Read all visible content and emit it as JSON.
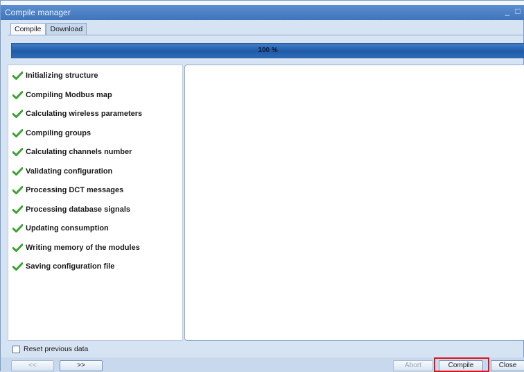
{
  "window": {
    "title": "Compile manager",
    "controls": [
      "minimize",
      "maximize"
    ]
  },
  "tabs": [
    {
      "label": "Compile",
      "active": true
    },
    {
      "label": "Download",
      "active": false
    }
  ],
  "progress": {
    "label": "100 %",
    "percent": 100
  },
  "steps": [
    {
      "label": "Initializing structure",
      "status": "done"
    },
    {
      "label": "Compiling Modbus map",
      "status": "done"
    },
    {
      "label": "Calculating wireless parameters",
      "status": "done"
    },
    {
      "label": "Compiling groups",
      "status": "done"
    },
    {
      "label": "Calculating channels number",
      "status": "done"
    },
    {
      "label": "Validating configuration",
      "status": "done"
    },
    {
      "label": "Processing DCT messages",
      "status": "done"
    },
    {
      "label": "Processing database signals",
      "status": "done"
    },
    {
      "label": "Updating consumption",
      "status": "done"
    },
    {
      "label": "Writing memory of the modules",
      "status": "done"
    },
    {
      "label": "Saving configuration file",
      "status": "done"
    }
  ],
  "options": {
    "reset_label": "Reset previous data",
    "reset_checked": false
  },
  "buttons": {
    "prev": "<<",
    "next": ">>",
    "abort": "Abort",
    "compile": "Compile",
    "close": "Close"
  },
  "colors": {
    "accent": "#2a62ad",
    "check": "#3aa32f",
    "highlight": "#e0131b"
  }
}
